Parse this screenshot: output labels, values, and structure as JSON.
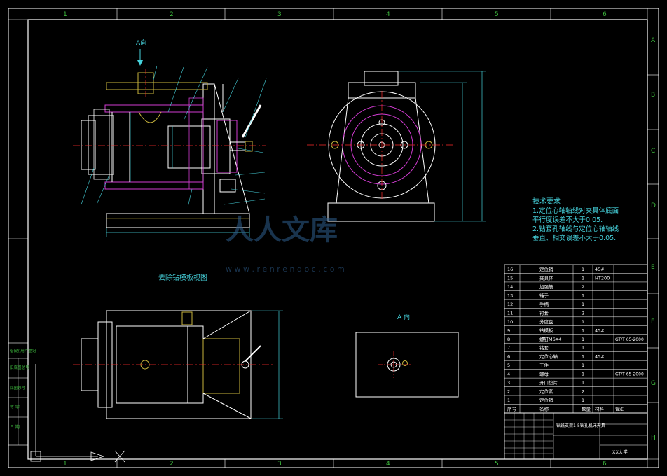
{
  "border": {
    "columns_top": [
      "1",
      "2",
      "3",
      "4",
      "5",
      "6"
    ],
    "columns_bottom": [
      "1",
      "2",
      "3",
      "4",
      "5",
      "6"
    ],
    "rows_right": [
      "A",
      "B",
      "C",
      "D",
      "E",
      "F",
      "G",
      "H"
    ]
  },
  "views": {
    "view_a_arrow_label": "A向",
    "view_a_title": "A 向",
    "removed_plate_title": "去除钻模板视图"
  },
  "tech_requirements": {
    "title": "技术要求",
    "lines": [
      "1.定位心轴轴线对夹具体底面",
      "  平行度误差不大于0.05.",
      "2.钻套孔轴线与定位心轴轴线",
      "  垂直、相交误差不大于0.05."
    ]
  },
  "watermark": {
    "text": "人人文库",
    "url": "w w w . r e n r e n d o c . c o m"
  },
  "parts_list": {
    "rows": [
      {
        "no": "16",
        "name": "定位销",
        "qty": "1",
        "material": "45#",
        "remark": ""
      },
      {
        "no": "15",
        "name": "夹具体",
        "qty": "1",
        "material": "HT200",
        "remark": ""
      },
      {
        "no": "14",
        "name": "加强筋",
        "qty": "2",
        "material": "",
        "remark": ""
      },
      {
        "no": "13",
        "name": "锤手",
        "qty": "1",
        "material": "",
        "remark": ""
      },
      {
        "no": "12",
        "name": "手柄",
        "qty": "1",
        "material": "",
        "remark": ""
      },
      {
        "no": "11",
        "name": "衬套",
        "qty": "2",
        "material": "",
        "remark": ""
      },
      {
        "no": "10",
        "name": "分度盘",
        "qty": "1",
        "material": "",
        "remark": ""
      },
      {
        "no": "9",
        "name": "钻模板",
        "qty": "1",
        "material": "45#",
        "remark": ""
      },
      {
        "no": "8",
        "name": "螺钉M6X4",
        "qty": "1",
        "material": "",
        "remark": "GT/T 65-2000"
      },
      {
        "no": "7",
        "name": "钻套",
        "qty": "1",
        "material": "",
        "remark": ""
      },
      {
        "no": "6",
        "name": "定位心轴",
        "qty": "1",
        "material": "45#",
        "remark": ""
      },
      {
        "no": "5",
        "name": "工件",
        "qty": "1",
        "material": "",
        "remark": ""
      },
      {
        "no": "4",
        "name": "螺母",
        "qty": "1",
        "material": "",
        "remark": "GT/T 65-2000"
      },
      {
        "no": "3",
        "name": "开口垫片",
        "qty": "1",
        "material": "",
        "remark": ""
      },
      {
        "no": "2",
        "name": "定位套",
        "qty": "2",
        "material": "",
        "remark": ""
      },
      {
        "no": "1",
        "name": "定位销",
        "qty": "1",
        "material": "",
        "remark": ""
      }
    ],
    "header": {
      "no": "序号",
      "name": "名称",
      "qty": "数量",
      "material": "材料",
      "remark": "备注"
    }
  },
  "title_block": {
    "drawing_title": "钻铣支架1-5钻孔机床夹具",
    "unit": "XX大学"
  },
  "side_stamp": {
    "labels": [
      "借(通)用件登记",
      "旧底图总号",
      "底图总号",
      "签 字",
      "日 期"
    ]
  },
  "colors": {
    "background": "#000000",
    "frame": "#ffffff",
    "zone_text": "#3fbf3f",
    "dimension": "#46d2dc",
    "centerline": "#ff2a2a",
    "section": "#d23cd2",
    "hatch": "#c8b43c",
    "outline": "#ffffff"
  }
}
